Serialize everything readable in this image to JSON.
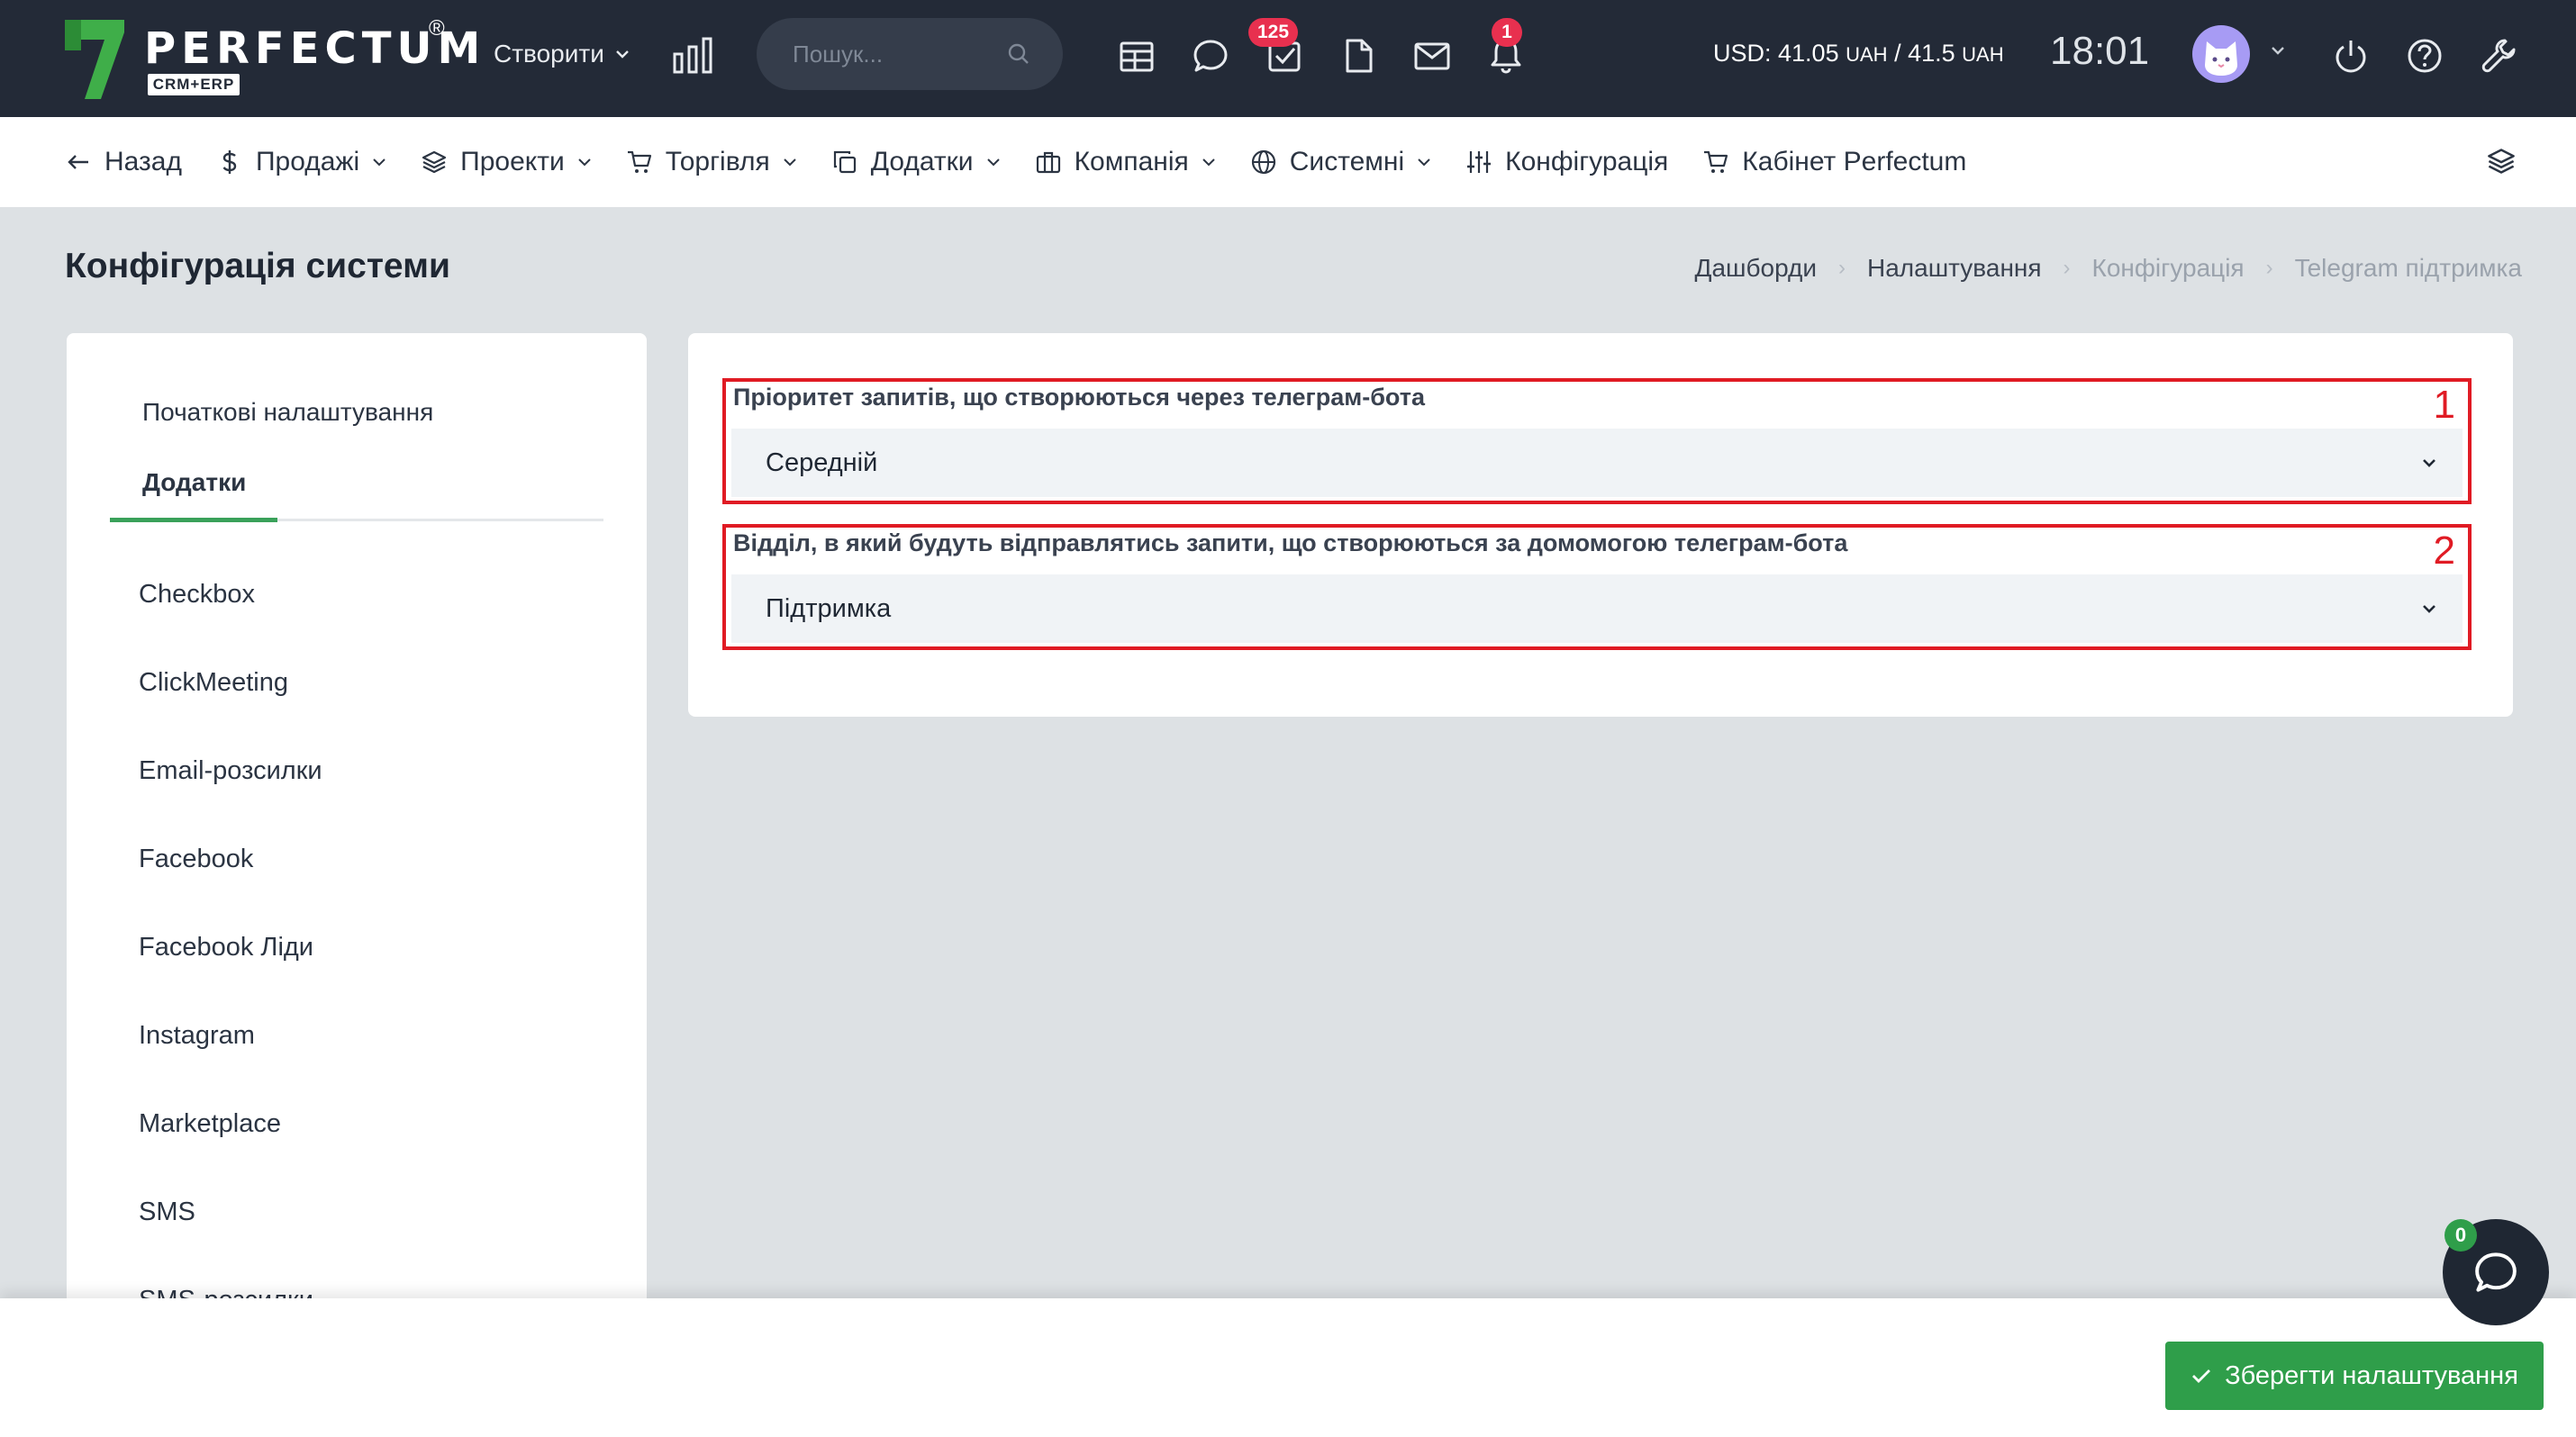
{
  "brand": {
    "name": "PERFECTUM",
    "registered": "®",
    "tagline": "CRM+ERP"
  },
  "topbar": {
    "create_label": "Створити",
    "search_placeholder": "Пошук...",
    "tasks_badge": "125",
    "notifications_badge": "1",
    "currency": {
      "prefix": "USD: ",
      "buy": "41.05",
      "unit": "UAH",
      "separator": " / ",
      "sell": "41.5"
    },
    "time": "18:01"
  },
  "menu": {
    "back": "Назад",
    "sales": "Продажі",
    "projects": "Проекти",
    "trade": "Торгівля",
    "addons": "Додатки",
    "company": "Компанія",
    "system": "Системні",
    "config": "Конфігурація",
    "cabinet": "Кабінет Perfectum"
  },
  "page": {
    "title": "Конфігурація системи",
    "breadcrumb": [
      "Дашборди",
      "Налаштування",
      "Конфігурація",
      "Telegram підтримка"
    ]
  },
  "sidebar": {
    "tabs": [
      "Початкові налаштування",
      "Додатки"
    ],
    "items": [
      "Checkbox",
      "ClickMeeting",
      "Email-розсилки",
      "Facebook",
      "Facebook Ліди",
      "Instagram",
      "Marketplace",
      "SMS",
      "SMS-розсилки"
    ]
  },
  "form": {
    "priority": {
      "label": "Пріоритет запитів, що створюються через телеграм-бота",
      "value": "Середній",
      "marker": "1"
    },
    "department": {
      "label": "Відділ, в який будуть відправлятись запити, що створюються за домомогою телеграм-бота",
      "value": "Підтримка",
      "marker": "2"
    }
  },
  "footer": {
    "save_label": "Зберегти налаштування"
  },
  "chat": {
    "unread": "0"
  },
  "colors": {
    "topbar": "#232a37",
    "accent": "#3aa15a",
    "save": "#2f9e4a",
    "badge": "#e8304f",
    "highlight": "#e01b24"
  }
}
